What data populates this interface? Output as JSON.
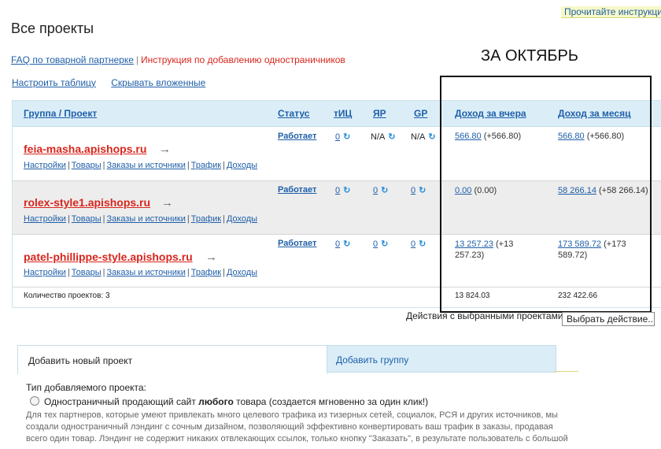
{
  "top_note": "Прочитайте инструкци",
  "page_title": "Все проекты",
  "faq_link": "FAQ по товарной партнерке",
  "faq_sep": "|",
  "instruction_link": "Инструкция по добавлению одностраничников",
  "month_label": "ЗА ОКТЯБРЬ",
  "tools": {
    "configure": "Настроить таблицу",
    "hide_nested": "Скрывать вложенные"
  },
  "table": {
    "headers": [
      "Группа / Проект",
      "Статус",
      "тИЦ",
      "ЯР",
      "GP",
      "Доход за вчера",
      "Доход за месяц"
    ],
    "rows": [
      {
        "name": "feia-masha.apishops.ru",
        "links": [
          "Настройки",
          "Товары",
          "Заказы и источники",
          "Трафик",
          "Доходы"
        ],
        "status": "Работает",
        "tic": "0",
        "yar": "N/A",
        "gp": "N/A",
        "income_yesterday_link": "566.80",
        "income_yesterday_delta": "(+566.80)",
        "income_month_link": "566.80",
        "income_month_delta": "(+566.80)"
      },
      {
        "name": "rolex-style1.apishops.ru",
        "links": [
          "Настройки",
          "Товары",
          "Заказы и источники",
          "Трафик",
          "Доходы"
        ],
        "status": "Работает",
        "tic": "0",
        "yar": "0",
        "gp": "0",
        "income_yesterday_link": "0.00",
        "income_yesterday_delta": "(0.00)",
        "income_month_link": "58 266.14",
        "income_month_delta": "(+58 266.14)"
      },
      {
        "name": "patel-phillippe-style.apishops.ru",
        "links": [
          "Настройки",
          "Товары",
          "Заказы и источники",
          "Трафик",
          "Доходы"
        ],
        "status": "Работает",
        "tic": "0",
        "yar": "0",
        "gp": "0",
        "income_yesterday_link": "13 257.23",
        "income_yesterday_delta": "(+13 257.23)",
        "income_month_link": "173 589.72",
        "income_month_delta": "(+173 589.72)"
      }
    ],
    "footer": {
      "count_label": "Количество проектов: 3",
      "total_yesterday": "13 824.03",
      "total_month": "232 422.66"
    }
  },
  "actions_label": "Действия с выбранными проектами",
  "action_select": "Выбрать действие..",
  "tabs": {
    "add_project": "Добавить новый проект",
    "add_group": "Добавить группу"
  },
  "project_type_label": "Тип добавляемого проекта:",
  "option_prefix": "Одностраничный продающий сайт ",
  "option_bold": "любого",
  "option_suffix": " товара (создается мгновенно за один клик!)",
  "description": "Для тех партнеров, которые умеют привлекать много целевого трафика из тизерных сетей, социалок, РСЯ и других источников, мы создали одностраничный лэндинг с сочным дизайном, позволяющий эффективно конвертировать ваш трафик в заказы, продавая всего один товар. Лэндинг не содержит никаких отвлекающих ссылок, только кнопку \"Заказать\", в результате пользователь с большой",
  "colors": {
    "link": "#1f5fa8",
    "project_name": "#d8261d",
    "header_bg": "#dbeef8",
    "row_alt": "#ededed"
  },
  "icons": {
    "refresh": "refresh-icon",
    "arrow": "arrow-right-icon"
  }
}
